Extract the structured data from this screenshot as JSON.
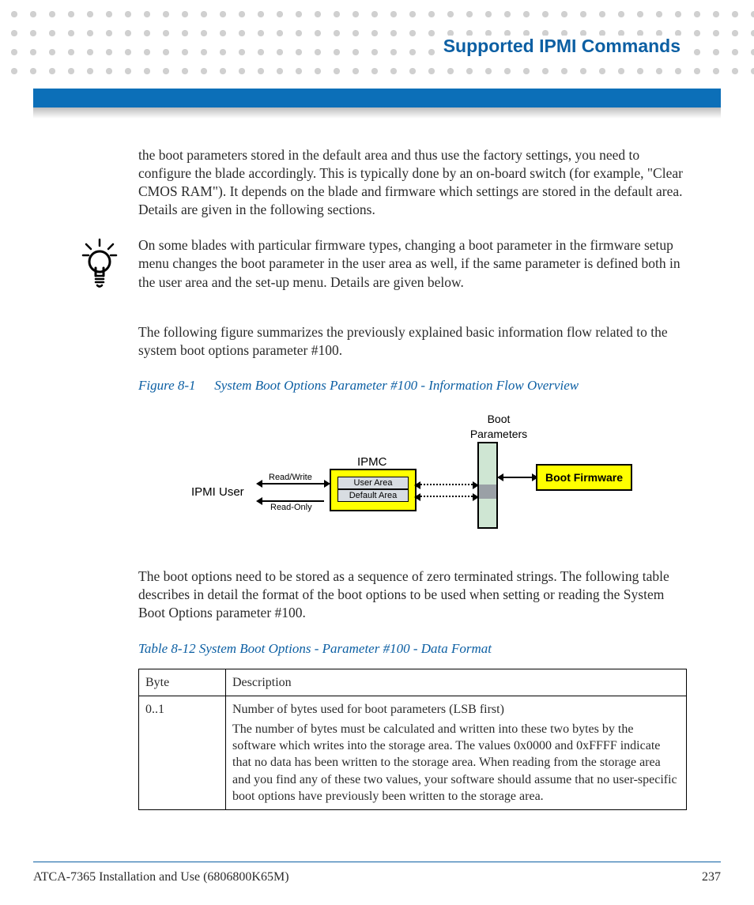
{
  "header": {
    "title": "Supported IPMI Commands"
  },
  "body": {
    "para1": "the boot parameters stored in the default area and thus use the factory settings, you need to configure the blade accordingly. This is typically done by an on-board switch (for example, \"Clear CMOS RAM\"). It depends on the blade and firmware which settings are stored in the default area. Details are given in the following sections.",
    "note": "On some blades with particular firmware types, changing a boot parameter in the firmware setup menu changes the boot parameter in the user area as well, if the same parameter is defined both in the user area and the set-up menu. Details are given below.",
    "para2": "The following figure summarizes the previously explained basic information flow related to the system boot options parameter #100.",
    "figure": {
      "label": "Figure 8-1",
      "caption": "System Boot Options Parameter #100 - Information Flow Overview",
      "labels": {
        "ipmi_user": "IPMI User",
        "read_write": "Read/Write",
        "read_only": "Read-Only",
        "ipmc": "IPMC",
        "user_area": "User Area",
        "default_area": "Default Area",
        "boot_parameters": "Boot\nParameters",
        "boot_firmware": "Boot Firmware"
      }
    },
    "para3": "The boot options need to be stored as a sequence of zero terminated strings. The following table describes in detail the format of the boot options to be used when setting or reading the System Boot Options parameter #100.",
    "table": {
      "caption": "Table 8-12 System Boot Options - Parameter #100 - Data Format",
      "headers": {
        "col0": "Byte",
        "col1": "Description"
      },
      "rows": [
        {
          "byte": "0..1",
          "desc1": "Number of bytes used for boot parameters (LSB first)",
          "desc2": "The number of bytes must be calculated and written into these two bytes by the software which writes into the storage area. The values 0x0000 and 0xFFFF indicate that no data has been written to the storage area. When reading from the storage area and you find any of these two values, your software should assume that no user-specific boot options have previously been written to the storage area."
        }
      ]
    }
  },
  "footer": {
    "doc": "ATCA-7365 Installation and Use (6806800K65M)",
    "page": "237"
  }
}
